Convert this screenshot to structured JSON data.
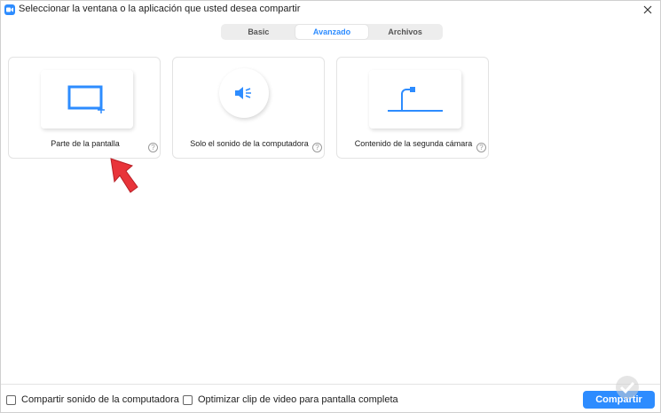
{
  "window": {
    "title": "Seleccionar la ventana o la aplicación que usted desea compartir"
  },
  "tabs": [
    {
      "label": "Basic",
      "active": false
    },
    {
      "label": "Avanzado",
      "active": true
    },
    {
      "label": "Archivos",
      "active": false
    }
  ],
  "options": [
    {
      "label": "Parte de la pantalla",
      "icon": "screen-portion-icon",
      "help": "?"
    },
    {
      "label": "Solo el sonido de la computadora",
      "icon": "speaker-icon",
      "help": "?"
    },
    {
      "label": "Contenido de la segunda cámara",
      "icon": "document-camera-icon",
      "help": "?"
    }
  ],
  "footer": {
    "share_sound_label": "Compartir sonido de la computadora",
    "share_sound_checked": false,
    "optimize_video_label": "Optimizar clip de video para pantalla completa",
    "optimize_video_checked": false,
    "share_button_label": "Compartir"
  },
  "colors": {
    "accent": "#2d8cff",
    "arrow": "#e8343a"
  }
}
